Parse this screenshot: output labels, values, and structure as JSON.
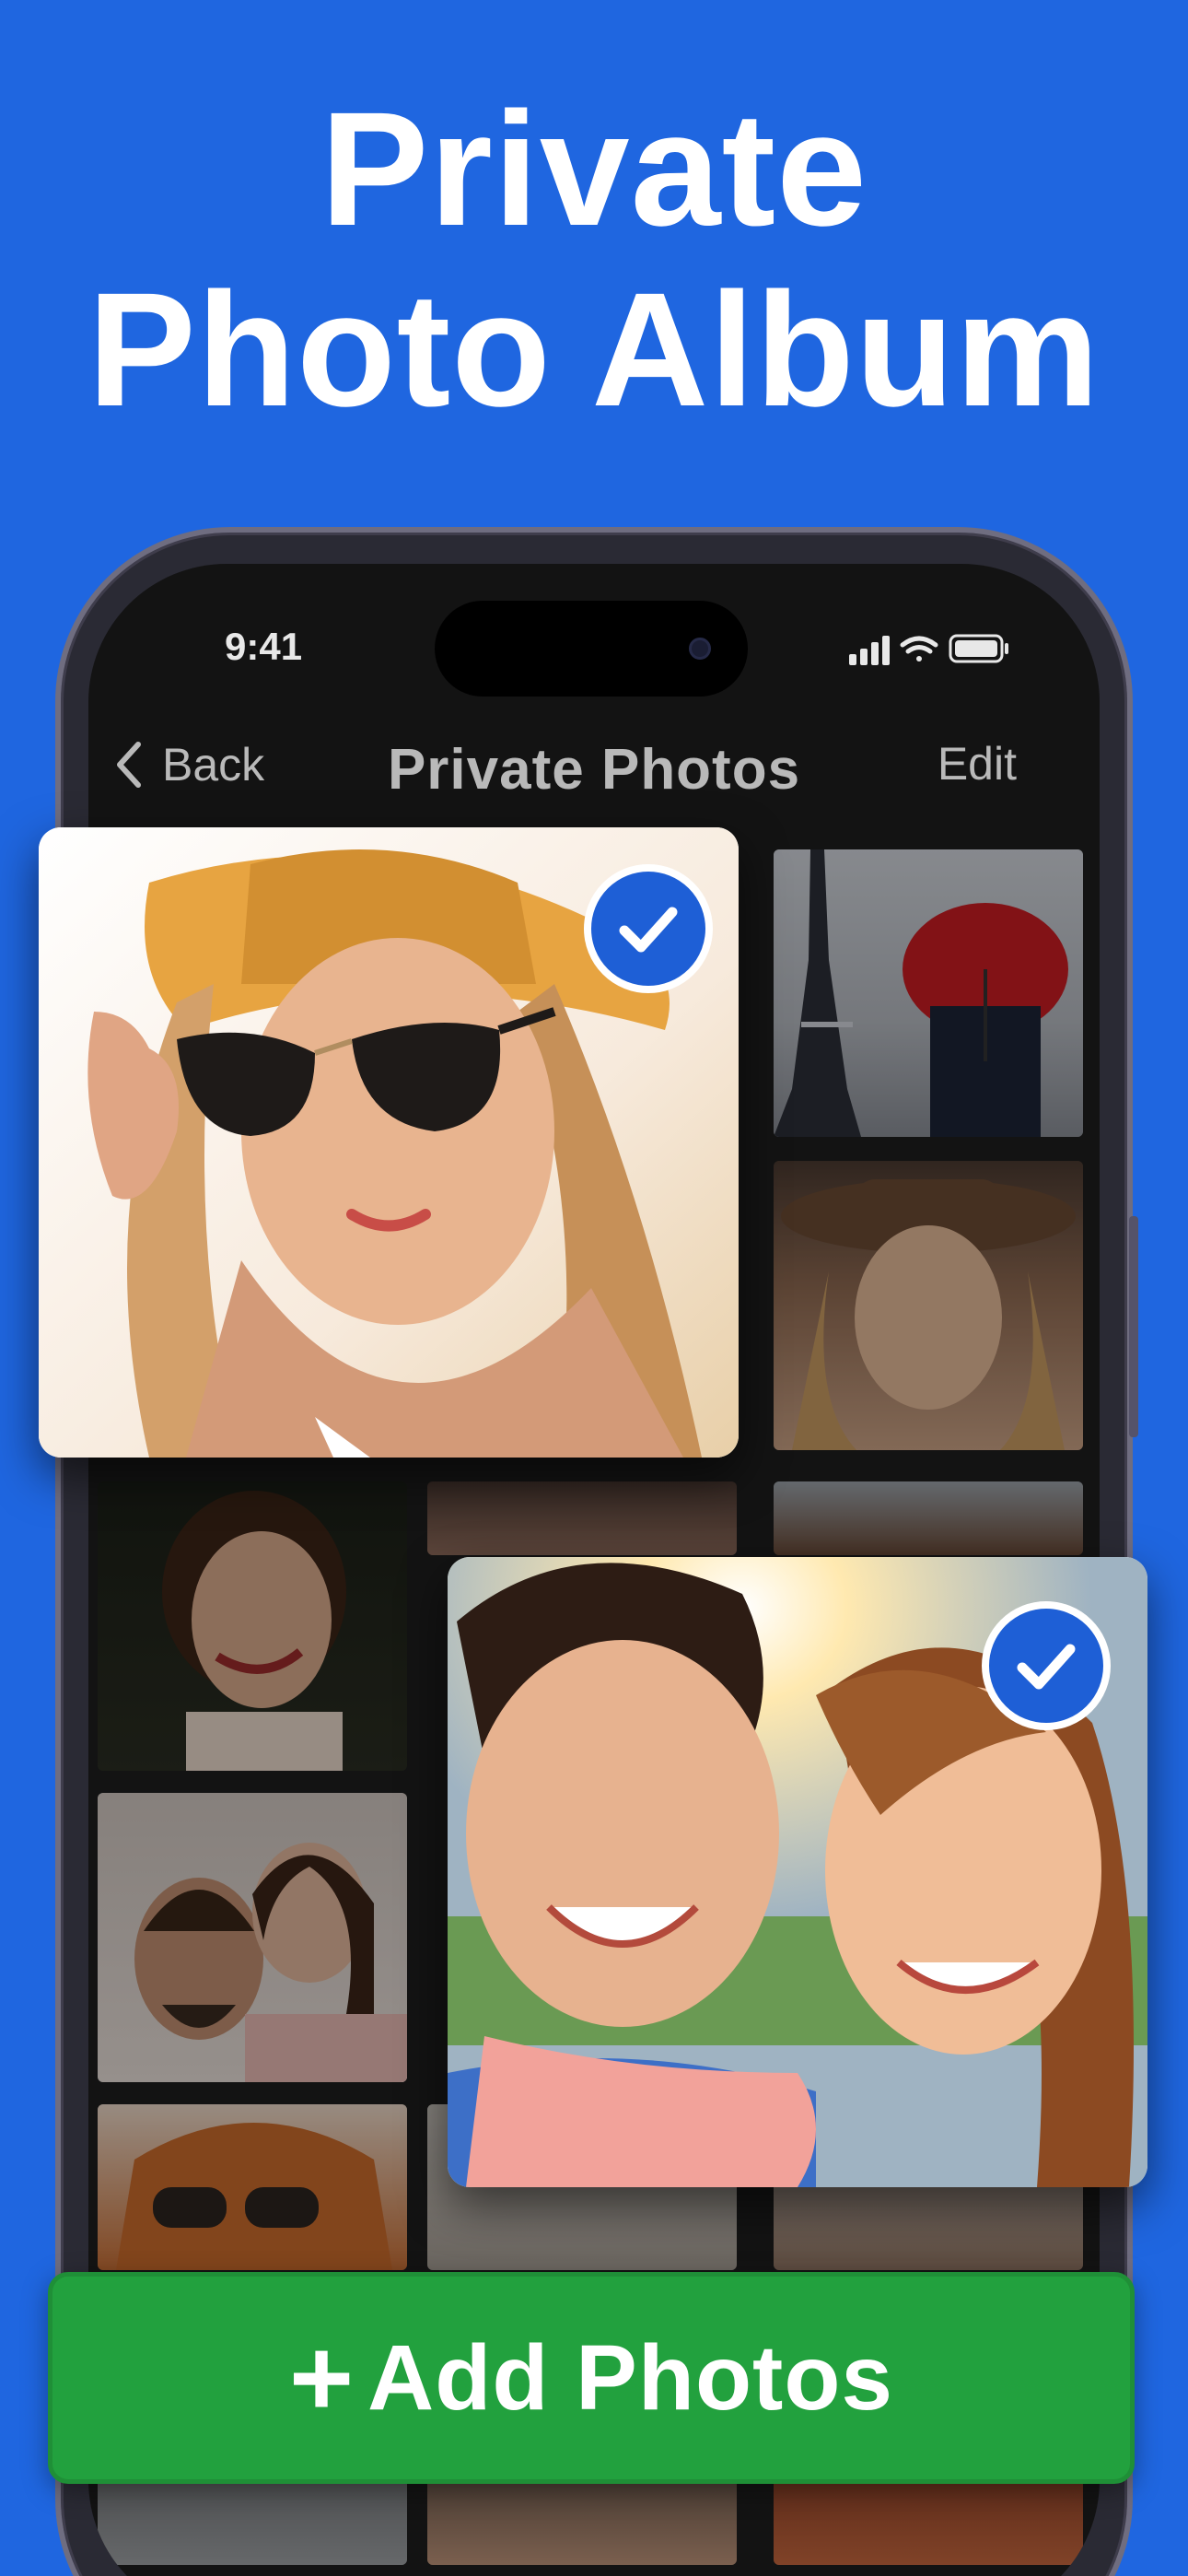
{
  "headline": {
    "line1": "Private",
    "line2": "Photo Album"
  },
  "status": {
    "time": "9:41"
  },
  "nav": {
    "back": "Back",
    "title": "Private Photos",
    "edit": "Edit"
  },
  "cta": {
    "plus": "+",
    "label": "Add Photos"
  },
  "photos": [
    {
      "id": "eiffel-umbrella",
      "selected": false
    },
    {
      "id": "woman-brown-hat",
      "selected": false
    },
    {
      "id": "woman-earrings",
      "selected": false
    },
    {
      "id": "man-face-top",
      "selected": false
    },
    {
      "id": "man-hair-top",
      "selected": false
    },
    {
      "id": "couple-lying",
      "selected": false
    },
    {
      "id": "woman-sunglasses-red-hair",
      "selected": false
    },
    {
      "id": "woman-straw-hat-sunglasses",
      "selected": true
    },
    {
      "id": "couple-selfie",
      "selected": true
    }
  ],
  "colors": {
    "background": "#1f66e0",
    "accent_check": "#1e5fd6",
    "cta": "#22a13e"
  }
}
